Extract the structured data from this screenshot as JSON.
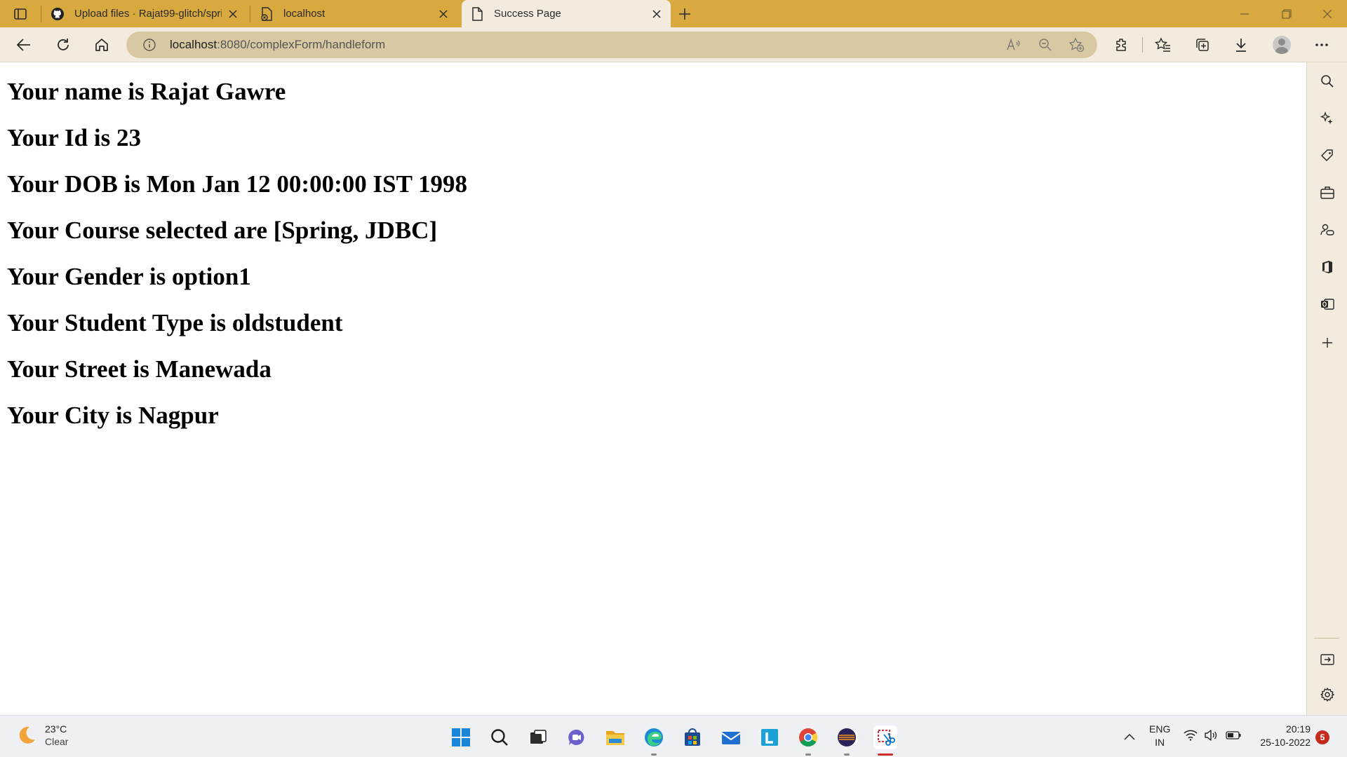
{
  "browser": {
    "tabs": [
      {
        "title": "Upload files · Rajat99-glitch/spri",
        "favicon": "github-icon"
      },
      {
        "title": "localhost",
        "favicon": "page-error-icon"
      },
      {
        "title": "Success Page",
        "favicon": "page-icon",
        "active": true
      }
    ],
    "address": {
      "host": "localhost",
      "rest": ":8080/complexForm/handleform"
    }
  },
  "page": {
    "lines": [
      "Your name is Rajat Gawre",
      "Your Id is 23",
      "Your DOB is Mon Jan 12 00:00:00 IST 1998",
      "Your Course selected are [Spring, JDBC]",
      "Your Gender is option1",
      "Your Student Type is oldstudent",
      "Your Street is Manewada",
      "Your City is Nagpur"
    ]
  },
  "taskbar": {
    "weather": {
      "temp": "23°C",
      "condition": "Clear"
    },
    "apps": [
      "start-icon",
      "search-icon",
      "task-view-icon",
      "teams-chat-icon",
      "file-explorer-icon",
      "edge-icon",
      "store-icon",
      "mail-icon",
      "l-app-icon",
      "chrome-icon",
      "eclipse-icon",
      "snipping-tool-icon"
    ],
    "language": {
      "line1": "ENG",
      "line2": "IN"
    },
    "clock": {
      "time": "20:19",
      "date": "25-10-2022"
    },
    "notification_count": "5"
  },
  "colors": {
    "tabbar": "#d8a93f",
    "toolbar": "#f3ecde",
    "omnibox": "#d9c9a3"
  }
}
